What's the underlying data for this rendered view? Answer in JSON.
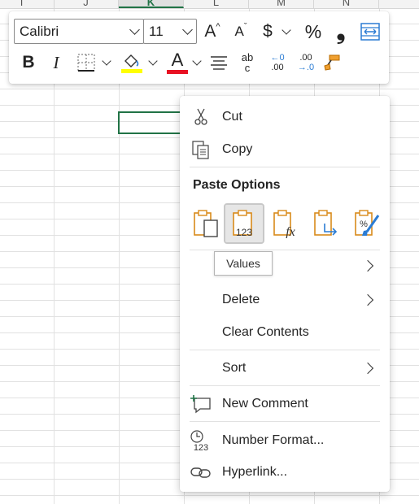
{
  "sheet": {
    "columns": [
      "I",
      "J",
      "K",
      "L",
      "M",
      "N"
    ],
    "selected_column": "K"
  },
  "toolbar": {
    "font_name": "Calibri",
    "font_size": "11",
    "increase_font_icon": "A",
    "decrease_font_icon": "A",
    "currency_symbol": "$",
    "percent_symbol": "%",
    "comma_symbol": "❟",
    "bold": "B",
    "italic": "I",
    "font_color_letter": "A",
    "highlight_color": "#ffff00",
    "font_color": "#e81123",
    "increase_decimal_top": "←0",
    "increase_decimal_bottom": ".00",
    "decrease_decimal_top": ".00",
    "decrease_decimal_bottom": "→.0",
    "wrap_top": "ab",
    "wrap_bottom": "c"
  },
  "menu": {
    "cut": "Cut",
    "copy": "Copy",
    "paste_options_title": "Paste Options",
    "paste_values_icon_text": "123",
    "paste_formula_icon_text": "fx",
    "delete": "Delete",
    "clear_contents": "Clear Contents",
    "sort": "Sort",
    "new_comment": "New Comment",
    "number_format": "Number Format...",
    "number_format_icon_text": "123",
    "hyperlink": "Hyperlink..."
  },
  "tooltip": "Values",
  "colors": {
    "accent_green": "#217346",
    "paste_orange": "#d98a1a",
    "icon_blue": "#2b7cd3"
  }
}
